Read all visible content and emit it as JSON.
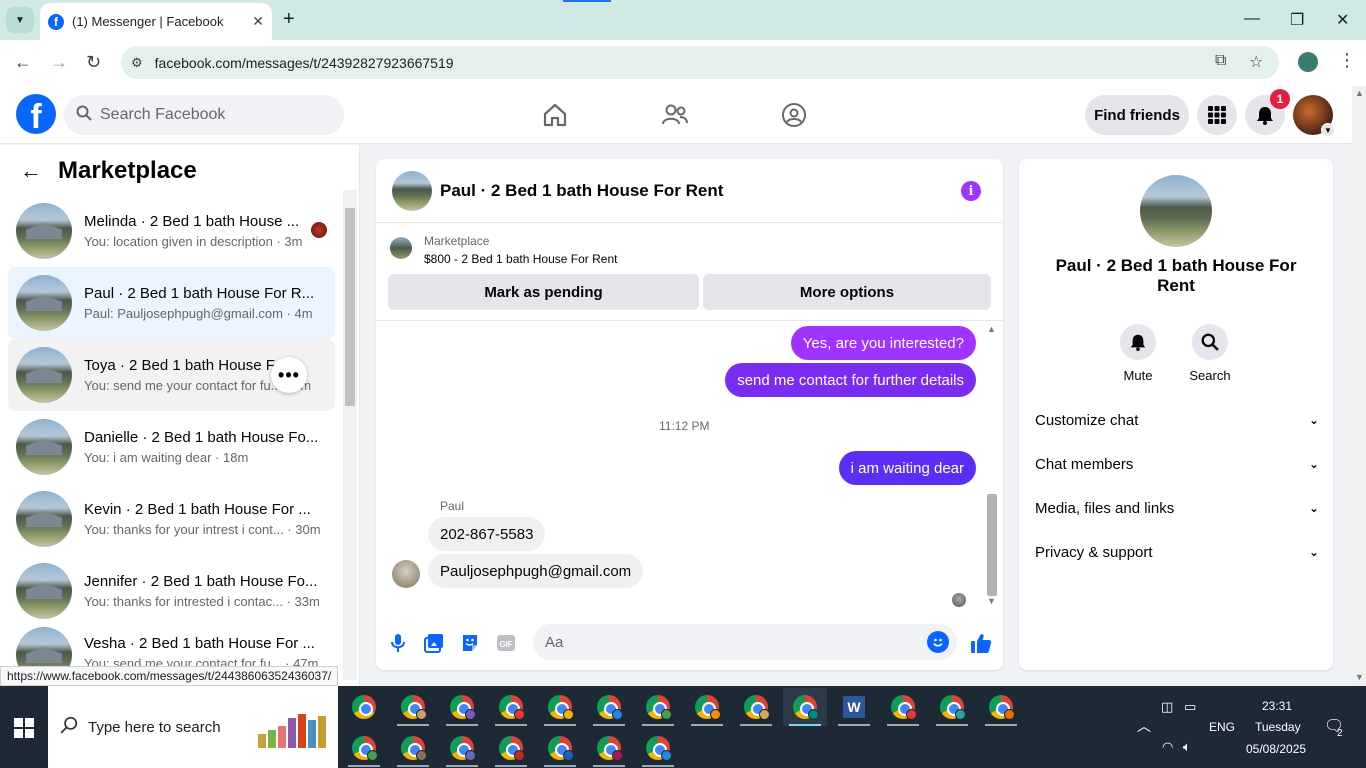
{
  "browser": {
    "tab_title": "(1) Messenger | Facebook",
    "url": "facebook.com/messages/t/24392827923667519",
    "status_url": "https://www.facebook.com/messages/t/24438606352436037/"
  },
  "header": {
    "search_placeholder": "Search Facebook",
    "find_friends": "Find friends",
    "notification_count": "1"
  },
  "sidebar": {
    "title": "Marketplace",
    "conversations": [
      {
        "name": "Melinda · 2 Bed 1 bath House ...",
        "preview": "You: location given in description · 3m"
      },
      {
        "name": "Paul · 2 Bed 1 bath House For R...",
        "preview": "Paul: Pauljosephpugh@gmail.com · 4m"
      },
      {
        "name": "Toya · 2 Bed 1 bath House Fo...",
        "preview": "You: send me your contact for fu... · 5m"
      },
      {
        "name": "Danielle · 2 Bed 1 bath House Fo...",
        "preview": "You: i am waiting dear · 18m"
      },
      {
        "name": "Kevin · 2 Bed 1 bath House For ...",
        "preview": "You: thanks for your intrest i cont... · 30m"
      },
      {
        "name": "Jennifer · 2 Bed 1 bath House Fo...",
        "preview": "You: thanks for intrested i contac... · 33m"
      },
      {
        "name": "Vesha · 2 Bed 1 bath House For ...",
        "preview": "You: send me your contact for fu... · 47m"
      }
    ]
  },
  "chat": {
    "title": "Paul · 2 Bed 1 bath House For Rent",
    "marketplace_label": "Marketplace",
    "listing": "$800 - 2 Bed 1 bath House For Rent",
    "mark_pending": "Mark as pending",
    "more_options": "More options",
    "messages": {
      "m1": "Yes, are you interested?",
      "m2": "send me contact for further details",
      "time": "11:12 PM",
      "m3": "i am waiting dear",
      "sender": "Paul",
      "m4": "202-867-5583",
      "m5": "Pauljosephpugh@gmail.com"
    },
    "composer_placeholder": "Aa"
  },
  "details": {
    "name": "Paul · 2 Bed 1 bath House For Rent",
    "mute": "Mute",
    "search": "Search",
    "sections": [
      "Customize chat",
      "Chat members",
      "Media, files and links",
      "Privacy & support"
    ]
  },
  "taskbar": {
    "search_placeholder": "Type here to search",
    "lang": "ENG",
    "time": "23:31",
    "day": "Tuesday",
    "date": "05/08/2025",
    "notifications": "2"
  },
  "colors": {
    "brand": "#0866ff",
    "bubble_purple": "#a033ff",
    "bubble_violet": "#6f2cf0",
    "bubble_indigo": "#5b2ef4"
  }
}
